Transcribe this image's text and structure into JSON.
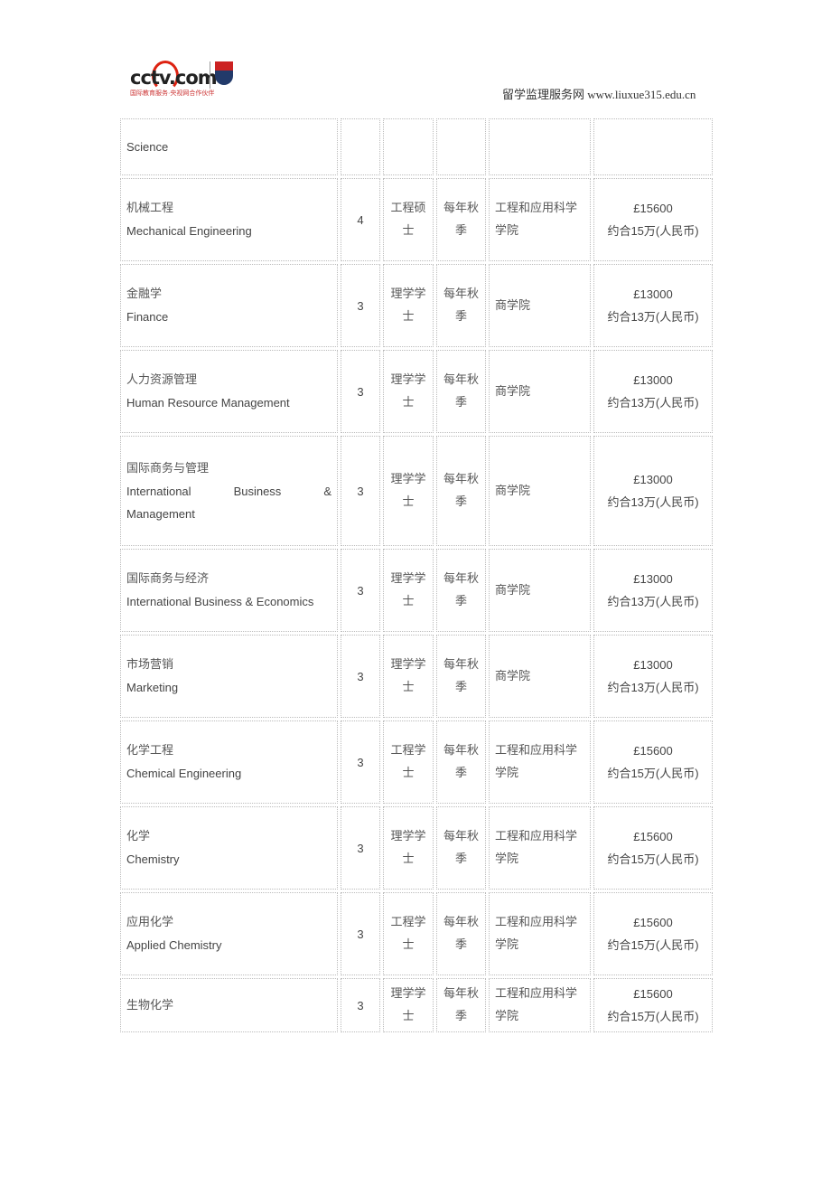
{
  "header": {
    "logo_text": "cctv.com",
    "logo_subtitle": "国际教育服务·央视网合作伙伴",
    "site_label": "留学监理服务网 www.liuxue315.edu.cn"
  },
  "rows": [
    {
      "cn": "",
      "en": "Science",
      "years": "",
      "degree": "",
      "intake": "",
      "school": "",
      "fee": "",
      "fee_rmb": ""
    },
    {
      "cn": "机械工程",
      "en": "Mechanical Engineering",
      "years": "4",
      "degree": "工程硕士",
      "intake": "每年秋季",
      "school": "工程和应用科学学院",
      "fee": "£15600",
      "fee_rmb": "约合15万(人民币)"
    },
    {
      "cn": "金融学",
      "en": "Finance",
      "years": "3",
      "degree": "理学学士",
      "intake": "每年秋季",
      "school": "商学院",
      "fee": "£13000",
      "fee_rmb": "约合13万(人民币)"
    },
    {
      "cn": "人力资源管理",
      "en": "Human Resource Management",
      "years": "3",
      "degree": "理学学士",
      "intake": "每年秋季",
      "school": "商学院",
      "fee": "£13000",
      "fee_rmb": "约合13万(人民币)"
    },
    {
      "cn": "国际商务与管理",
      "en": "International Business & Management",
      "years": "3",
      "degree": "理学学士",
      "intake": "每年秋季",
      "school": "商学院",
      "fee": "£13000",
      "fee_rmb": "约合13万(人民币)"
    },
    {
      "cn": "国际商务与经济",
      "en": "International Business & Economics",
      "years": "3",
      "degree": "理学学士",
      "intake": "每年秋季",
      "school": "商学院",
      "fee": "£13000",
      "fee_rmb": "约合13万(人民币)"
    },
    {
      "cn": "市场营销",
      "en": "Marketing",
      "years": "3",
      "degree": "理学学士",
      "intake": "每年秋季",
      "school": "商学院",
      "fee": "£13000",
      "fee_rmb": "约合13万(人民币)"
    },
    {
      "cn": "化学工程",
      "en": "Chemical Engineering",
      "years": "3",
      "degree": "工程学士",
      "intake": "每年秋季",
      "school": "工程和应用科学学院",
      "fee": "£15600",
      "fee_rmb": "约合15万(人民币)"
    },
    {
      "cn": "化学",
      "en": "Chemistry",
      "years": "3",
      "degree": "理学学士",
      "intake": "每年秋季",
      "school": "工程和应用科学学院",
      "fee": "£15600",
      "fee_rmb": "约合15万(人民币)"
    },
    {
      "cn": "应用化学",
      "en": "Applied Chemistry",
      "years": "3",
      "degree": "工程学士",
      "intake": "每年秋季",
      "school": "工程和应用科学学院",
      "fee": "£15600",
      "fee_rmb": "约合15万(人民币)"
    },
    {
      "cn": "生物化学",
      "en": "",
      "years": "3",
      "degree": "理学学士",
      "intake": "每年秋季",
      "school": "工程和应用科学学院",
      "fee": "£15600",
      "fee_rmb": "约合15万(人民币)"
    }
  ]
}
